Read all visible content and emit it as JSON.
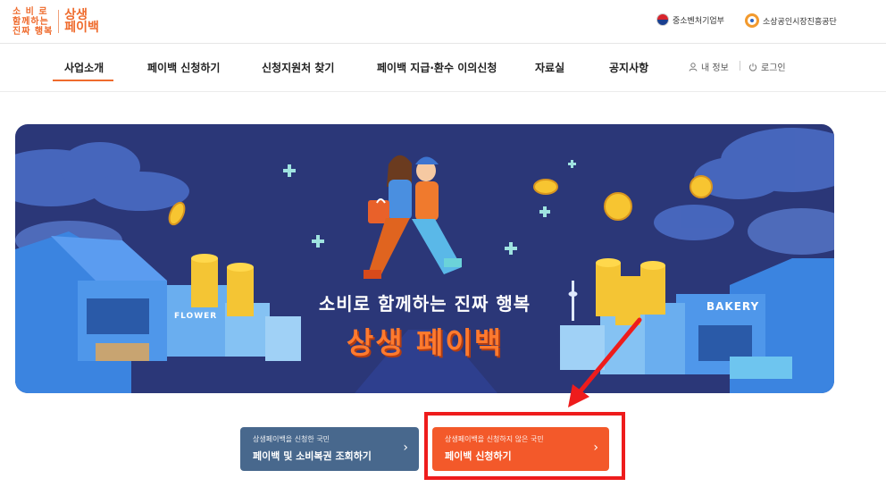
{
  "header": {
    "logo_left_line1": "소 비 로",
    "logo_left_line2": "함께하는",
    "logo_left_line3": "진짜 행복",
    "logo_right_line1": "상생",
    "logo_right_line2": "페이백",
    "gov_links": [
      "중소벤처기업부",
      "소상공인시장진흥공단"
    ]
  },
  "nav": {
    "items": [
      "사업소개",
      "페이백 신청하기",
      "신청지원처 찾기",
      "페이백 지급·환수 이의신청",
      "자료실",
      "공지사항"
    ],
    "active_index": 0,
    "my_info": "내 정보",
    "login": "로그인"
  },
  "banner": {
    "text1": "소비로 함께하는 진짜 행복",
    "text2": "상생 페이백",
    "sign_flower": "FLOWER",
    "sign_bakery": "BAKERY"
  },
  "cta": {
    "left_sub": "상생페이백을 신청한 국민",
    "left_main": "페이백 및 소비복권 조회하기",
    "right_sub": "상생페이백을 신청하지 않은 국민",
    "right_main": "페이백 신청하기"
  },
  "colors": {
    "accent": "#ef6b2d",
    "banner_bg": "#2b3778",
    "cta_blue": "#48688d",
    "cta_orange": "#f3592a",
    "highlight": "#ee1c1c"
  }
}
